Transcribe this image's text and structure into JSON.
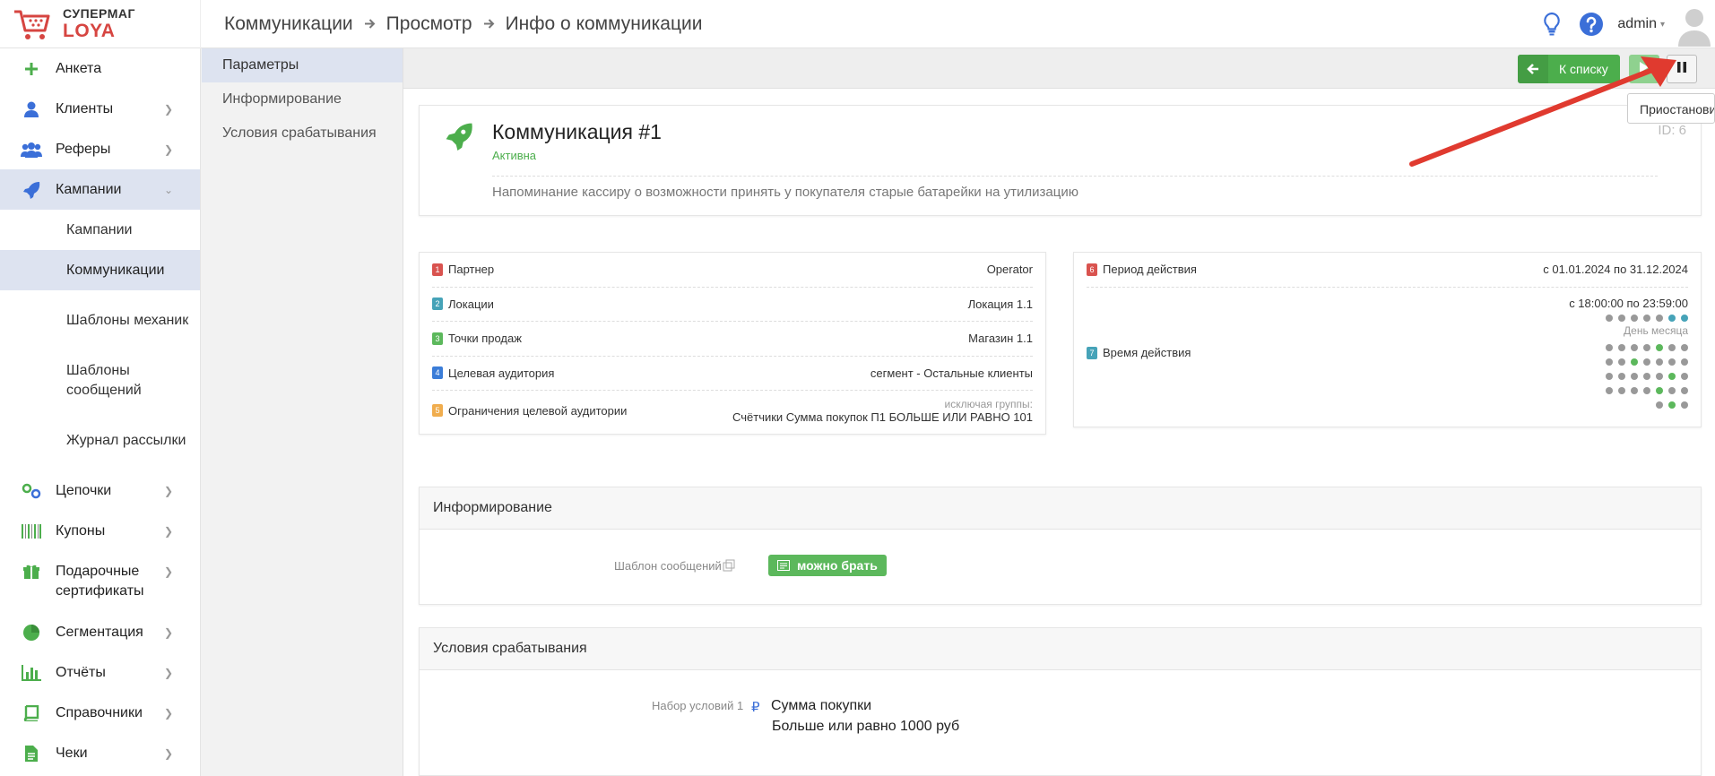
{
  "brand": {
    "line1": "СУПЕРМАГ",
    "line2": "LOYA",
    "accent": "#d64541"
  },
  "breadcrumb": [
    "Коммуникации",
    "Просмотр",
    "Инфо о коммуникации"
  ],
  "header": {
    "user": "admin",
    "icons": [
      "lightbulb-icon",
      "help-icon"
    ]
  },
  "sidebar": {
    "items": [
      {
        "label": "Анкета",
        "icon": "plus-icon"
      },
      {
        "label": "Клиенты",
        "icon": "user-icon"
      },
      {
        "label": "Рефеpы",
        "icon": "users-icon"
      },
      {
        "label": "Кампании",
        "icon": "rocket-icon"
      },
      {
        "label": "Цепочки",
        "icon": "chain-icon"
      },
      {
        "label": "Купоны",
        "icon": "barcode-icon"
      },
      {
        "label": "Подарочные сертификаты",
        "icon": "gift-icon"
      },
      {
        "label": "Сегментация",
        "icon": "pie-icon"
      },
      {
        "label": "Отчёты",
        "icon": "bar-chart-icon"
      },
      {
        "label": "Справочники",
        "icon": "book-icon"
      },
      {
        "label": "Чеки",
        "icon": "receipt-icon"
      }
    ],
    "sub": [
      "Кампании",
      "Коммуникации",
      "Шаблоны механик",
      "Шаблоны сообщений",
      "Журнал рассылки"
    ]
  },
  "subnav": [
    "Параметры",
    "Информирование",
    "Условия срабатывания"
  ],
  "toolbar": {
    "back": "К списку",
    "tooltip": "Приостановить"
  },
  "comm": {
    "title": "Коммуникация #1",
    "status": "Активна",
    "id": "ID: 6",
    "description": "Напоминание кассиру о возможности принять у покупателя старые батарейки на утилизацию"
  },
  "props": [
    {
      "n": "1",
      "color": "#d9534f",
      "label": "Партнер",
      "value": "Operator"
    },
    {
      "n": "2",
      "color": "#46a3b8",
      "label": "Локации",
      "value": "Локация 1.1"
    },
    {
      "n": "3",
      "color": "#5cb85c",
      "label": "Точки продаж",
      "value": "Магазин 1.1"
    },
    {
      "n": "4",
      "color": "#3b7dd8",
      "label": "Целевая аудитория",
      "value": "сегмент - Остальные клиенты"
    },
    {
      "n": "5",
      "color": "#f0ad4e",
      "label": "Ограничения целевой аудитории",
      "muted": "исключая группы:",
      "value": "Счётчики Сумма покупок П1 БОЛЬШЕ ИЛИ РАВНО 101"
    }
  ],
  "props2": {
    "period": {
      "n": "6",
      "color": "#d9534f",
      "label": "Период действия",
      "value": "с 01.01.2024 по 31.12.2024"
    },
    "time": {
      "n": "7",
      "color": "#46a3b8",
      "label": "Время действия",
      "value": "с 18:00:00 по 23:59:00",
      "month_label": "День месяца"
    },
    "week_dots": [
      "#999",
      "#999",
      "#999",
      "#999",
      "#999",
      "#46a3b8",
      "#46a3b8"
    ],
    "month_rows": [
      [
        "#999",
        "#999",
        "#999",
        "#999",
        "#5cb85c",
        "#999",
        "#999"
      ],
      [
        "#999",
        "#999",
        "#5cb85c",
        "#999",
        "#999",
        "#999",
        "#999"
      ],
      [
        "#999",
        "#999",
        "#999",
        "#999",
        "#999",
        "#5cb85c",
        "#999"
      ],
      [
        "#999",
        "#999",
        "#999",
        "#999",
        "#5cb85c",
        "#999",
        "#999"
      ],
      [
        "#999",
        "#5cb85c",
        "#999"
      ]
    ]
  },
  "info": {
    "title": "Информирование",
    "label": "Шаблон сообщений",
    "tag": "можно брать"
  },
  "cond": {
    "title": "Условия срабатывания",
    "label": "Набор условий 1",
    "line1": "Сумма покупки",
    "line2": "Больше или равно 1000 руб"
  }
}
